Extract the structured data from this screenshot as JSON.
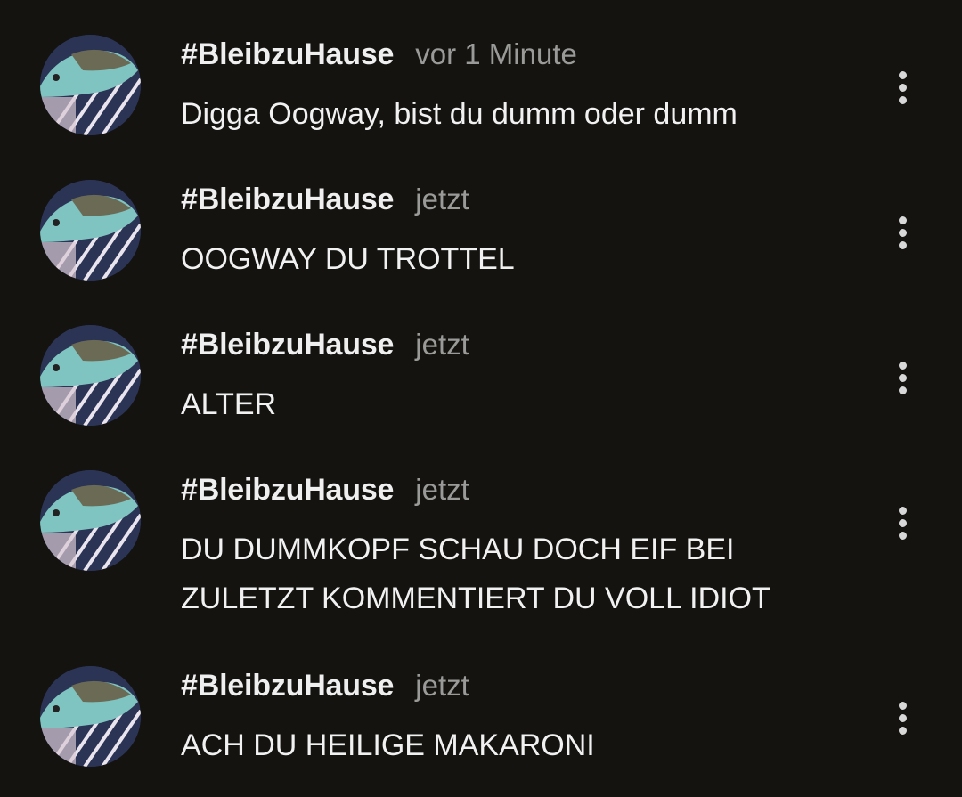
{
  "comments": [
    {
      "author": "#BleibzuHause",
      "time": "vor 1 Minute",
      "text": "Digga Oogway, bist du dumm oder dumm",
      "menu_icon": "more-vert-icon"
    },
    {
      "author": "#BleibzuHause",
      "time": "jetzt",
      "text": "OOGWAY DU TROTTEL",
      "menu_icon": "more-vert-icon"
    },
    {
      "author": "#BleibzuHause",
      "time": "jetzt",
      "text": "ALTER",
      "menu_icon": "more-vert-icon"
    },
    {
      "author": "#BleibzuHause",
      "time": "jetzt",
      "text": "DU DUMMKOPF SCHAU DOCH EIF BEI\nZULETZT KOMMENTIERT DU VOLL IDIOT",
      "menu_icon": "more-vert-icon"
    },
    {
      "author": "#BleibzuHause",
      "time": "jetzt",
      "text": "ACH DU HEILIGE MAKARONI",
      "menu_icon": "more-vert-icon"
    }
  ],
  "colors": {
    "background": "#141310",
    "author": "#efefef",
    "timestamp": "#9a9a98",
    "text": "#f1f1f1"
  }
}
